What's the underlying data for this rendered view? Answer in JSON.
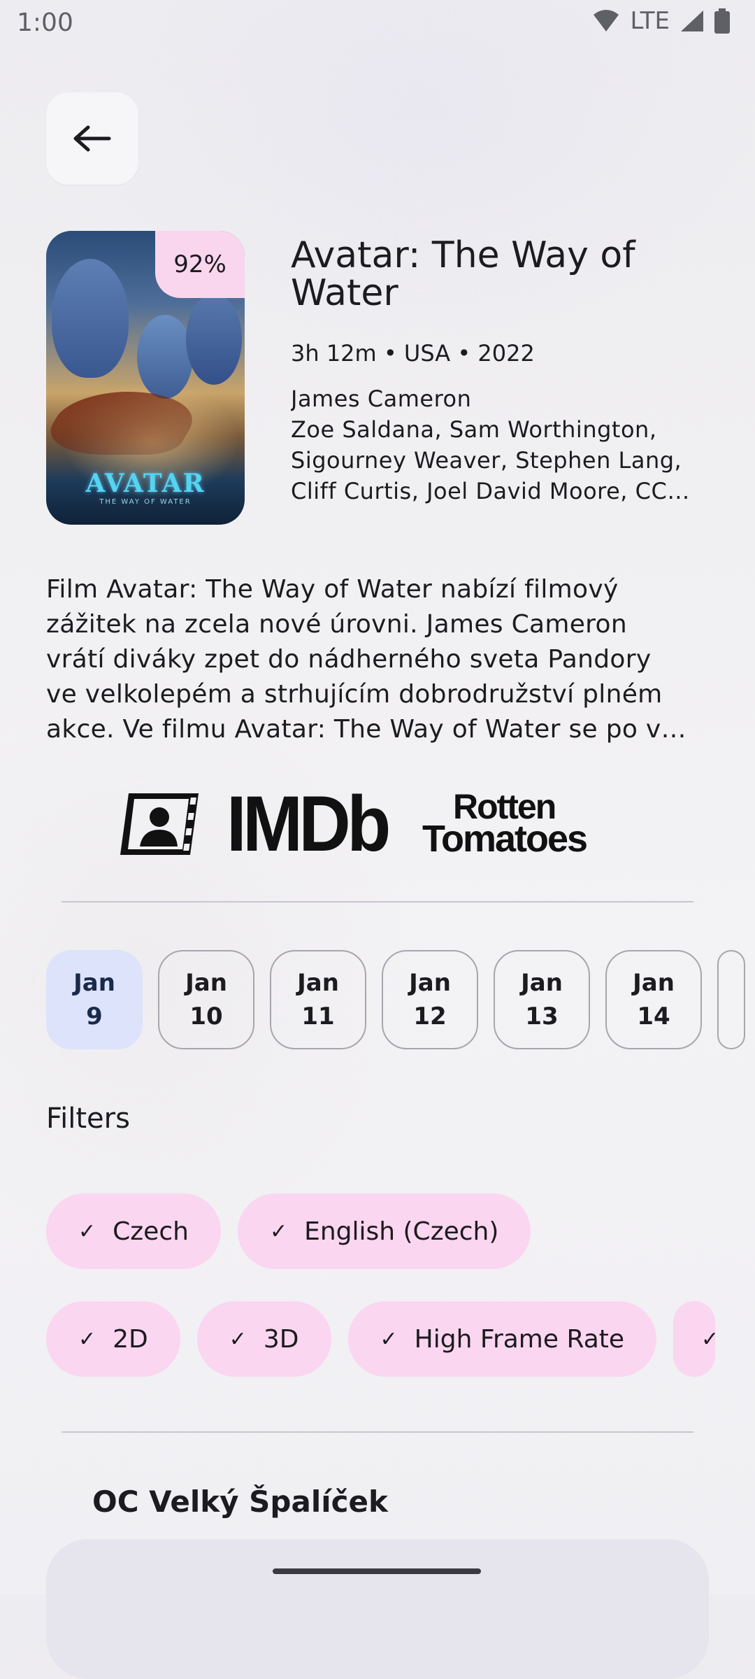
{
  "status_bar": {
    "time": "1:00",
    "network": "LTE"
  },
  "movie": {
    "title": "Avatar: The Way of Water",
    "score": "92%",
    "meta": "3h 12m • USA • 2022",
    "director": "James Cameron",
    "cast_lines": [
      "Zoe Saldana, Sam Worthington,",
      "Sigourney Weaver, Stephen Lang,",
      "Cliff Curtis, Joel David Moore, CC…"
    ],
    "poster_title": "AVATAR",
    "poster_subtitle": "THE WAY OF WATER",
    "description_lines": [
      "Film Avatar: The Way of Water nabízí filmový",
      "zážitek na zcela nové úrovni. James Cameron",
      "vrátí diváky zpet do nádherného sveta Pandory",
      "ve velkolepém a strhujícím dobrodružství plném",
      "akce. Ve filmu Avatar: The Way of Water se po v…"
    ]
  },
  "logos": {
    "imdb": "IMDb",
    "rt_line1": "Rotten",
    "rt_line2": "Tomatoes"
  },
  "dates": [
    {
      "month": "Jan",
      "day": "9",
      "selected": true
    },
    {
      "month": "Jan",
      "day": "10"
    },
    {
      "month": "Jan",
      "day": "11"
    },
    {
      "month": "Jan",
      "day": "12"
    },
    {
      "month": "Jan",
      "day": "13"
    },
    {
      "month": "Jan",
      "day": "14"
    }
  ],
  "filters": {
    "title": "Filters",
    "languages": [
      "Czech",
      "English (Czech)"
    ],
    "formats": [
      "2D",
      "3D",
      "High Frame Rate"
    ]
  },
  "cinema": {
    "name": "OC Velký Špalíček"
  },
  "colors": {
    "accent_pink": "#fbd6f0",
    "selected_date": "#dce3fb"
  }
}
